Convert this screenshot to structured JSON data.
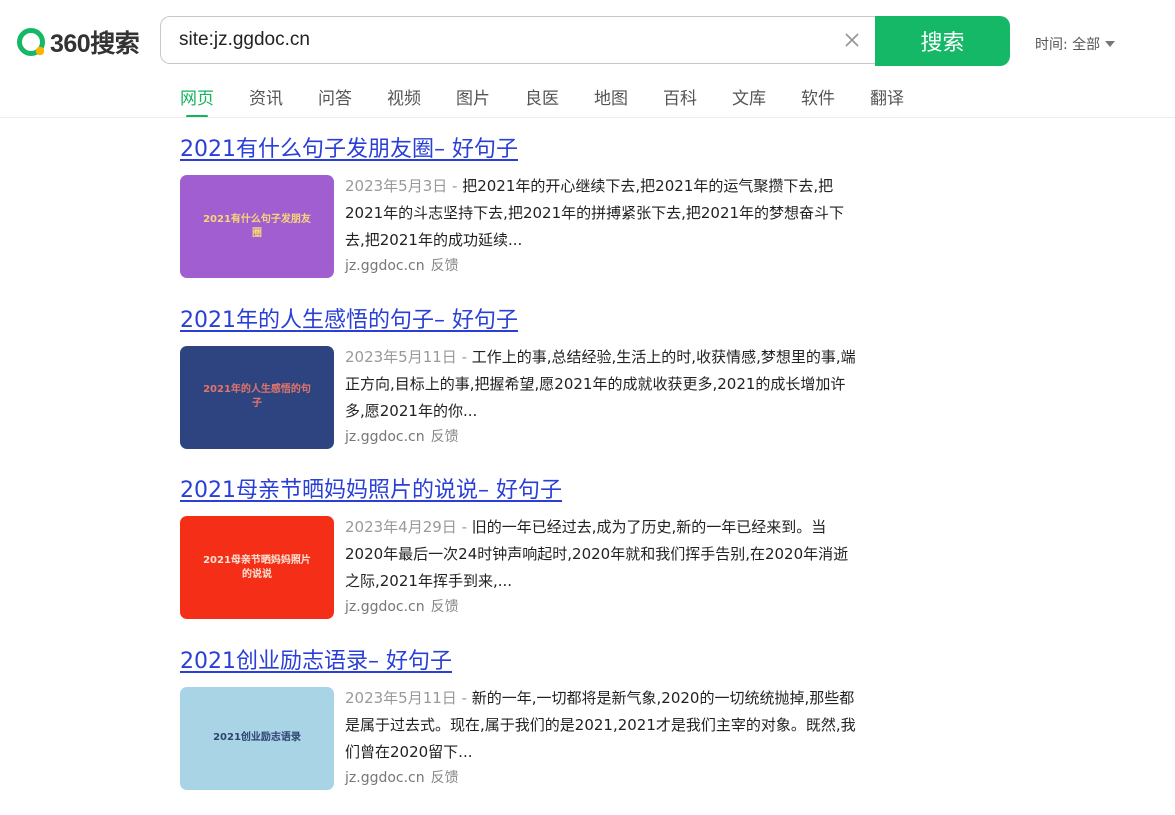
{
  "header": {
    "logo_text": "360搜索",
    "search_value": "site:jz.ggdoc.cn",
    "search_button": "搜索",
    "time_filter": "时间: 全部"
  },
  "tabs": [
    {
      "label": "网页",
      "active": true
    },
    {
      "label": "资讯"
    },
    {
      "label": "问答"
    },
    {
      "label": "视频"
    },
    {
      "label": "图片"
    },
    {
      "label": "良医"
    },
    {
      "label": "地图"
    },
    {
      "label": "百科"
    },
    {
      "label": "文库"
    },
    {
      "label": "软件"
    },
    {
      "label": "翻译"
    }
  ],
  "results": [
    {
      "title": "2021有什么句子发朋友圈– 好句子",
      "date": "2023年5月3日",
      "sep": " - ",
      "snippet": "把2021年的开心继续下去,把2021年的运气聚攒下去,把2021年的斗志坚持下去,把2021年的拼搏紧张下去,把2021年的梦想奋斗下去,把2021年的成功延续...",
      "domain": "jz.ggdoc.cn",
      "feedback": "反馈",
      "thumb_text": "2021有什么句子发朋友圈",
      "thumb_bg": "#a15ed1",
      "thumb_fg": "#f4d778"
    },
    {
      "title": "2021年的人生感悟的句子– 好句子",
      "date": "2023年5月11日",
      "sep": " - ",
      "snippet": "工作上的事,总结经验,生活上的时,收获情感,梦想里的事,端正方向,目标上的事,把握希望,愿2021年的成就收获更多,2021的成长增加许多,愿2021年的你...",
      "domain": "jz.ggdoc.cn",
      "feedback": "反馈",
      "thumb_text": "2021年的人生感悟的句子",
      "thumb_bg": "#2e4480",
      "thumb_fg": "#e2756a"
    },
    {
      "title": "2021母亲节晒妈妈照片的说说– 好句子",
      "date": "2023年4月29日",
      "sep": " - ",
      "snippet": "旧的一年已经过去,成为了历史,新的一年已经来到。当2020年最后一次24时钟声响起时,2020年就和我们挥手告别,在2020年消逝之际,2021年挥手到来,...",
      "domain": "jz.ggdoc.cn",
      "feedback": "反馈",
      "thumb_text": "2021母亲节晒妈妈照片的说说",
      "thumb_bg": "#f42e17",
      "thumb_fg": "#fbe3d5"
    },
    {
      "title": "2021创业励志语录– 好句子",
      "date": "2023年5月11日",
      "sep": " - ",
      "snippet": "新的一年,一切都将是新气象,2020的一切统统抛掉,那些都是属于过去式。现在,属于我们的是2021,2021才是我们主宰的对象。既然,我们曾在2020留下...",
      "domain": "jz.ggdoc.cn",
      "feedback": "反馈",
      "thumb_text": "2021创业励志语录",
      "thumb_bg": "#a8d4e6",
      "thumb_fg": "#2f4470"
    }
  ]
}
